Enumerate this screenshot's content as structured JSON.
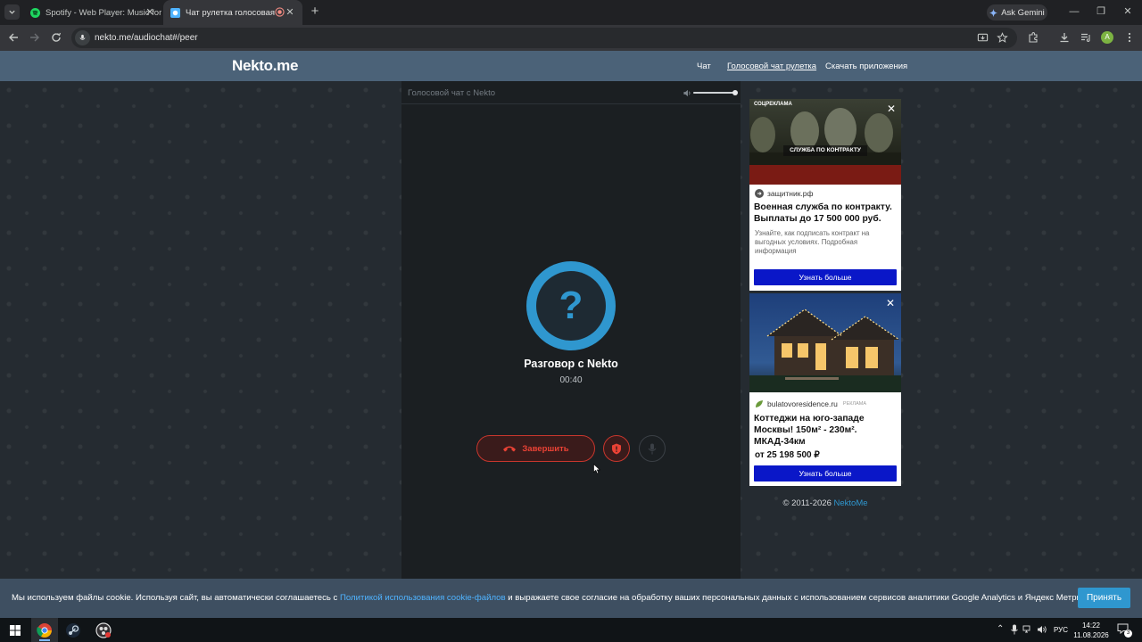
{
  "browser": {
    "tabs": [
      {
        "title": "Spotify - Web Player: Music for"
      },
      {
        "title": "Чат рулетка голосовая — Н"
      }
    ],
    "ask_gemini": "Ask Gemini",
    "url": "nekto.me/audiochat#/peer"
  },
  "site": {
    "logo": "Nekto.me",
    "nav": [
      "Чат",
      "Голосовой чат рулетка",
      "Скачать приложения"
    ]
  },
  "chat": {
    "panel_title": "Голосовой чат с Nekto",
    "volume_level": 0.95,
    "avatar_symbol": "?",
    "talk_title": "Разговор с Nekto",
    "timer": "00:40",
    "end_label": "Завершить"
  },
  "ads": [
    {
      "badge": "СОЦРЕКЛАМА",
      "image_caption": "СЛУЖБА ПО КОНТРАКТУ",
      "domain": "защитник.рф",
      "title": "Военная служба по контракту. Выплаты до 17 500 000 руб.",
      "desc": "Узнайте, как подписать контракт на выгодных условиях. Подробная информация",
      "button": "Узнать больше"
    },
    {
      "domain": "bulatovoresidence.ru",
      "label": "РЕКЛАМА",
      "title": "Коттеджи на юго-западе Москвы! 150м² - 230м². МКАД-34км",
      "price": "от 25 198 500 ₽",
      "button": "Узнать больше"
    }
  ],
  "footer": {
    "copyright": "© 2011-2026",
    "brand": "NektoMe"
  },
  "cookie": {
    "text_before": "Мы используем файлы cookie. Используя сайт, вы автоматически соглашаетесь с ",
    "link": "Политикой использования cookie-файлов",
    "text_after": " и выражаете свое согласие на обработку ваших персональных данных с использованием сервисов аналитики Google Analytics и Яндекс Метрика.",
    "accept": "Принять"
  },
  "taskbar": {
    "lang": "РУС",
    "time": "14:22",
    "date": "11.08.2026",
    "notifications": "3"
  }
}
